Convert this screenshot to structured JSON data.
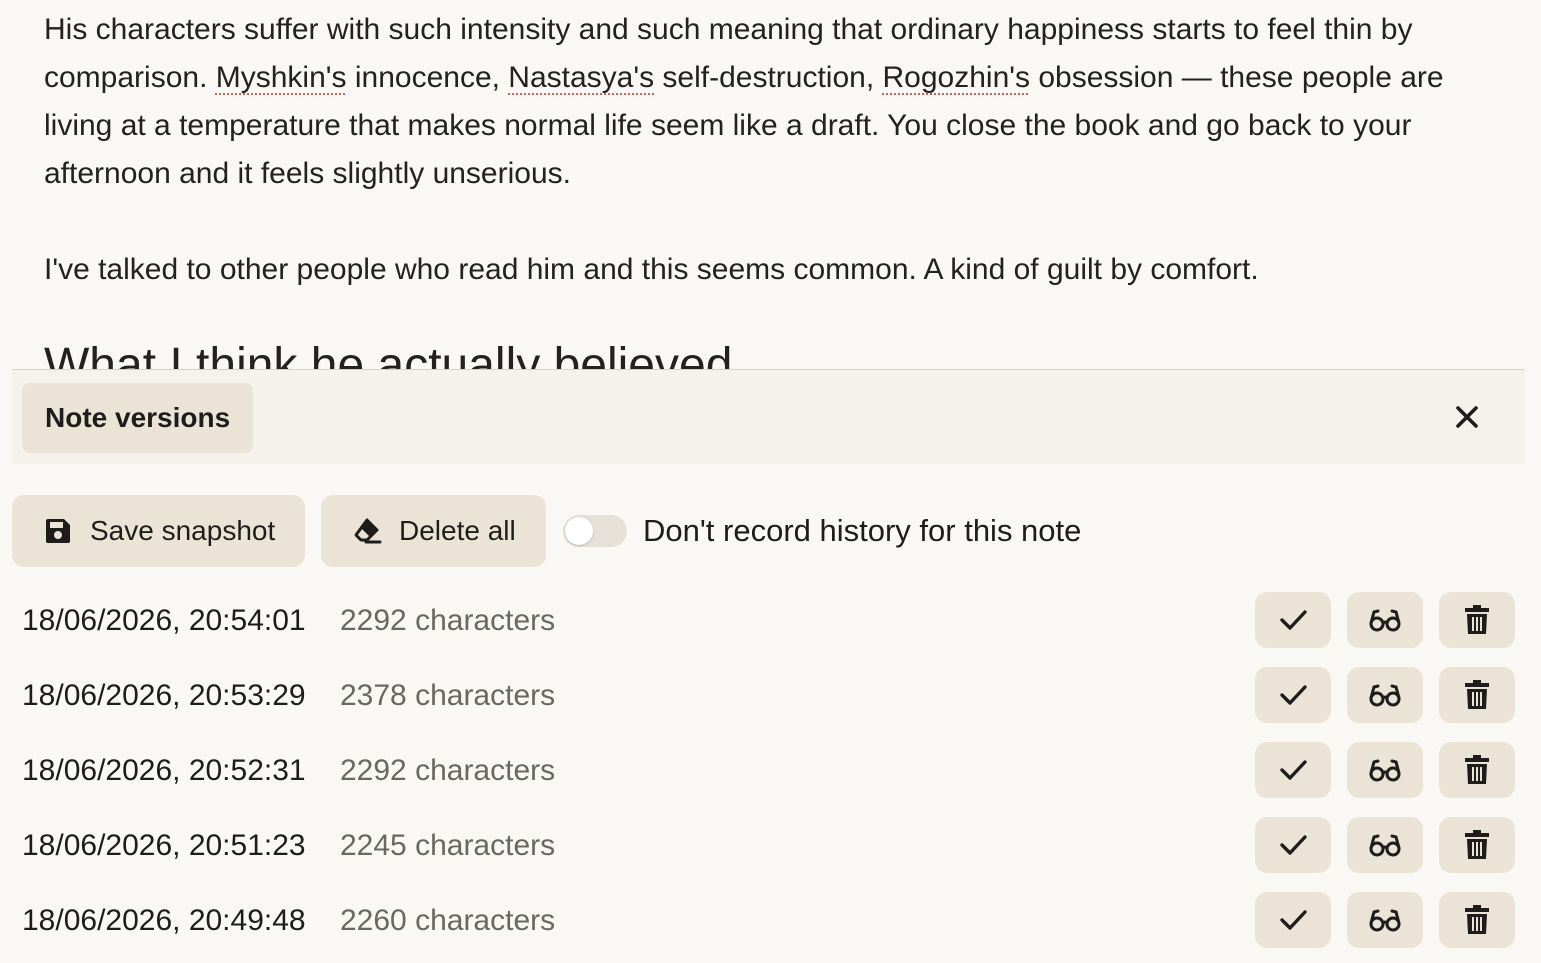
{
  "editor": {
    "p1_a": "His characters suffer with such intensity and such meaning that ordinary happiness starts to feel thin by comparison. ",
    "p1_name1": "Myshkin's",
    "p1_b": " innocence, ",
    "p1_name2": "Nastasya's",
    "p1_c": " self-destruction, ",
    "p1_name3": "Rogozhin's",
    "p1_d": " obsession — these people are living at a temperature that makes normal life seem like a draft. You close the book and go back to your afternoon and it feels slightly unserious.",
    "p2": "I've talked to other people who read him and this seems common. A kind of guilt by comfort.",
    "partial_heading": "What I think he actually believed"
  },
  "panel": {
    "title": "Note versions",
    "close_icon": "close-icon"
  },
  "toolbar": {
    "save_label": "Save snapshot",
    "save_icon": "floppy-disk-icon",
    "delete_label": "Delete all",
    "delete_icon": "eraser-icon",
    "toggle_label": "Don't record history for this note",
    "toggle_on": false
  },
  "versions": [
    {
      "timestamp": "18/06/2026, 20:54:01",
      "chars": "2292 characters"
    },
    {
      "timestamp": "18/06/2026, 20:53:29",
      "chars": "2378 characters"
    },
    {
      "timestamp": "18/06/2026, 20:52:31",
      "chars": "2292 characters"
    },
    {
      "timestamp": "18/06/2026, 20:51:23",
      "chars": "2245 characters"
    },
    {
      "timestamp": "18/06/2026, 20:49:48",
      "chars": "2260 characters"
    }
  ],
  "row_action_icons": [
    "checkmark-icon",
    "glasses-icon",
    "trash-icon"
  ],
  "colors": {
    "background": "#faf8f5",
    "button_bg": "#ebe4d6",
    "secondary_text": "#6b6762",
    "spellcheck": "#d65a5a"
  }
}
